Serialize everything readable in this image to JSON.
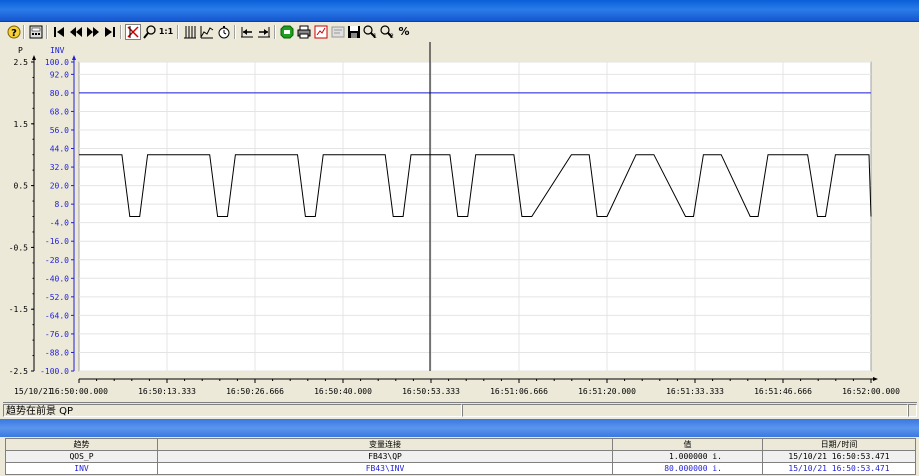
{
  "window": {
    "title": ""
  },
  "toolbar": {
    "items": [
      {
        "name": "help-icon",
        "glyph": "?"
      },
      {
        "name": "calculator-icon",
        "glyph": ""
      },
      {
        "name": "first-icon",
        "glyph": ""
      },
      {
        "name": "rewind-icon",
        "glyph": ""
      },
      {
        "name": "forward-icon",
        "glyph": ""
      },
      {
        "name": "last-icon",
        "glyph": ""
      },
      {
        "name": "ruler-icon",
        "glyph": ""
      },
      {
        "name": "zoom-icon",
        "glyph": ""
      },
      {
        "name": "original-size-icon",
        "glyph": "1:1"
      }
    ],
    "percent_label": "%"
  },
  "chart_data": {
    "type": "line",
    "x_ticks": [
      "16:50:00.000",
      "16:50:13.333",
      "16:50:26.666",
      "16:50:40.000",
      "16:50:53.333",
      "16:51:06.666",
      "16:51:20.000",
      "16:51:33.333",
      "16:51:46.666",
      "16:52:00.000"
    ],
    "date_label": "15/10/21",
    "x_range_seconds": [
      0,
      120
    ],
    "axis_left": {
      "label": "P",
      "range": [
        -2.5,
        2.5
      ],
      "ticks": [
        "2.5",
        "1.5",
        "0.5",
        "-0.5",
        "-1.5",
        "-2.5"
      ]
    },
    "axis_right": {
      "label": "INV",
      "range": [
        -100,
        100
      ],
      "ticks": [
        "100.0",
        "92.0",
        "80.0",
        "68.0",
        "56.0",
        "44.0",
        "32.0",
        "20.0",
        "8.0",
        "-4.0",
        "-16.0",
        "-28.0",
        "-40.0",
        "-52.0",
        "-64.0",
        "-76.0",
        "-88.0",
        "-100.0"
      ],
      "color": "#1e1ed8"
    },
    "cursor_time": "16:50:53.333",
    "series": [
      {
        "name": "QOS_P",
        "color": "#000000",
        "axis": "left",
        "step_high": 1.0,
        "step_low": 0.0,
        "points_t": [
          0,
          6.5,
          7.7,
          9.2,
          10.4,
          11.9,
          19.8,
          21.0,
          22.5,
          23.7,
          25.2,
          33.1,
          34.3,
          35.8,
          37.0,
          38.5,
          46.4,
          47.6,
          49.1,
          50.3,
          51.8,
          56.2,
          57.4,
          58.9,
          60.1,
          61.6,
          65.9,
          67.1,
          68.6,
          74.6,
          75.8,
          77.3,
          78.5,
          80.0,
          84.4,
          85.6,
          87.1,
          91.9,
          93.1,
          94.6,
          95.8,
          97.3,
          101.7,
          102.9,
          104.4,
          109.2,
          110.4,
          111.9,
          113.1,
          114.6,
          118.5,
          119.7,
          120
        ],
        "points_v": [
          1,
          1,
          0,
          0,
          1,
          1,
          1,
          0,
          0,
          1,
          1,
          1,
          0,
          0,
          1,
          1,
          1,
          0,
          0,
          1,
          1,
          1,
          0,
          0,
          1,
          1,
          1,
          0,
          0,
          1,
          1,
          1,
          0,
          0,
          1,
          1,
          1,
          0,
          0,
          1,
          1,
          1,
          0,
          0,
          1,
          1,
          1,
          0,
          0,
          1,
          1,
          1,
          0,
          0
        ]
      },
      {
        "name": "INV",
        "color": "#1e1ed8",
        "axis": "right",
        "value": 80.0
      }
    ],
    "grid": true
  },
  "status": {
    "text": "趋势在前景 QP",
    "cell2": "",
    "cell3": ""
  },
  "table": {
    "headers": [
      "趋势",
      "变量连接",
      "值",
      "日期/时间"
    ],
    "rows": [
      {
        "trend": "QOS_P",
        "link": "FB43\\QP",
        "value": "1.000000 i.",
        "datetime": "15/10/21 16:50:53.471"
      },
      {
        "trend": "INV",
        "link": "FB43\\INV",
        "value": "80.000000 i.",
        "datetime": "15/10/21 16:50:53.471"
      }
    ]
  }
}
